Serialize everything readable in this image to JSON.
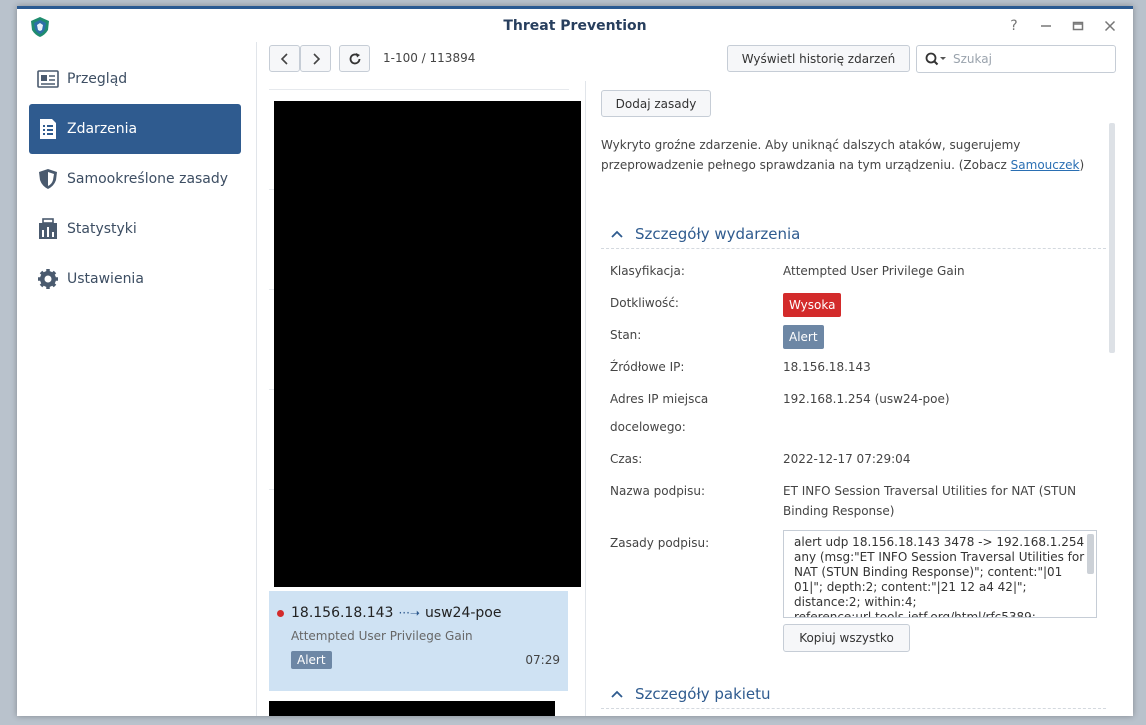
{
  "window": {
    "title": "Threat Prevention"
  },
  "sidebar": {
    "items": [
      {
        "label": "Przegląd",
        "icon": "overview-icon"
      },
      {
        "label": "Zdarzenia",
        "icon": "events-icon"
      },
      {
        "label": "Samookreślone zasady",
        "icon": "shield-icon"
      },
      {
        "label": "Statystyki",
        "icon": "statistics-icon"
      },
      {
        "label": "Ustawienia",
        "icon": "gear-icon"
      }
    ],
    "active_index": 1
  },
  "toolbar": {
    "counter": "1-100 / 113894",
    "history_label": "Wyświetl historię zdarzeń",
    "search_placeholder": "Szukaj"
  },
  "list": {
    "selected_item": {
      "source": "18.156.18.143",
      "destination": "usw24-poe",
      "description": "Attempted User Privilege Gain",
      "status": "Alert",
      "time": "07:29"
    }
  },
  "detail": {
    "add_rule_label": "Dodaj zasady",
    "warning_text": "Wykryto groźne zdarzenie. Aby uniknąć dalszych ataków, sugerujemy przeprowadzenie pełnego sprawdzania na tym urządzeniu. (Zobacz ",
    "warning_link": "Samouczek",
    "warning_end": ")",
    "event_section_title": "Szczegóły wydarzenia",
    "packet_section_title": "Szczegóły pakietu",
    "fields": {
      "classification_label": "Klasyfikacja:",
      "classification_value": "Attempted User Privilege Gain",
      "severity_label": "Dotkliwość:",
      "severity_value": "Wysoka",
      "state_label": "Stan:",
      "state_value": "Alert",
      "source_ip_label": "Źródłowe IP:",
      "source_ip_value": "18.156.18.143",
      "dest_ip_label_1": "Adres IP miejsca",
      "dest_ip_label_2": "docelowego:",
      "dest_ip_value": "192.168.1.254 (usw24-poe)",
      "time_label": "Czas:",
      "time_value": "2022-12-17 07:29:04",
      "signature_name_label": "Nazwa podpisu:",
      "signature_name_value": "ET INFO Session Traversal Utilities for NAT (STUN Binding Response)",
      "signature_rule_label": "Zasady podpisu:",
      "signature_rule_value": "alert udp 18.156.18.143 3478 -> 192.168.1.254 any  (msg:\"ET INFO Session Traversal Utilities for NAT (STUN Binding Response)\"; content:\"|01 01|\"; depth:2; content:\"|21 12 a4 42|\"; distance:2; within:4; reference:url,tools.ietf.org/html/rfc5389;",
      "copy_all_label": "Kopiuj wszystko"
    }
  },
  "colors": {
    "accent": "#2f5b8f",
    "severity_high": "#d32b2b",
    "alert_badge": "#6d87a5",
    "selected_row": "#cfe2f3"
  }
}
